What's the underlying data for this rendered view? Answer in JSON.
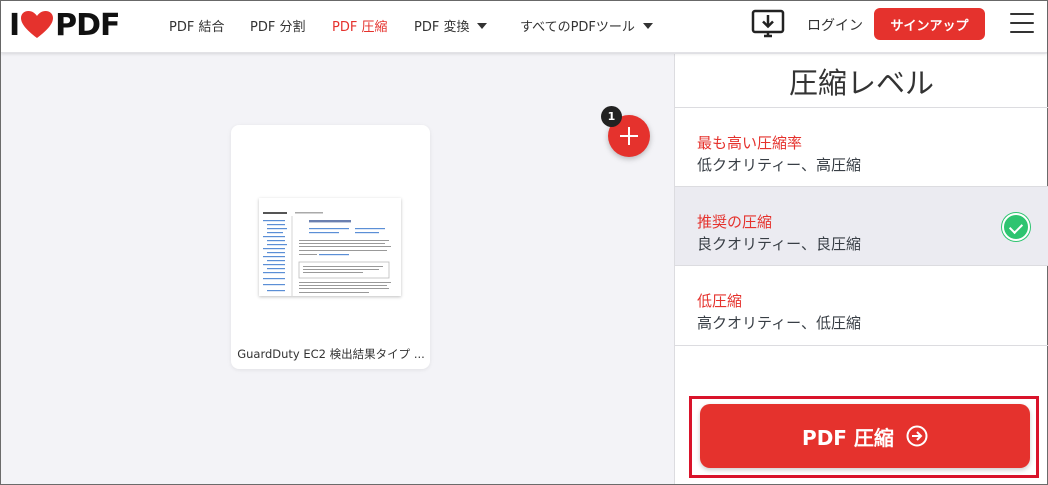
{
  "header": {
    "logo": {
      "left": "I",
      "right": "PDF"
    },
    "nav": [
      {
        "label": "PDF 結合",
        "active": false
      },
      {
        "label": "PDF 分割",
        "active": false
      },
      {
        "label": "PDF 圧縮",
        "active": true
      },
      {
        "label": "PDF 変換",
        "active": false,
        "dropdown": true
      },
      {
        "label": "すべてのPDFツール",
        "active": false,
        "dropdown": true
      }
    ],
    "desktop_icon": "desktop-download-icon",
    "login_label": "ログイン",
    "signup_label": "サインアップ",
    "menu_icon": "hamburger-menu-icon"
  },
  "workspace": {
    "file_count": "1",
    "file_name": "GuardDuty EC2 検出結果タイプ ...",
    "add_icon": "plus-icon"
  },
  "sidebar": {
    "title": "圧縮レベル",
    "options": [
      {
        "title": "最も高い圧縮率",
        "desc": "低クオリティー、高圧縮",
        "selected": false
      },
      {
        "title": "推奨の圧縮",
        "desc": "良クオリティー、良圧縮",
        "selected": true
      },
      {
        "title": "低圧縮",
        "desc": "高クオリティー、低圧縮",
        "selected": false
      }
    ],
    "compress_button_label": "PDF 圧縮"
  },
  "colors": {
    "brand_red": "#e5322d",
    "selected_bg": "#ebebf1",
    "check_green": "#2ec470",
    "highlight_border": "#d9132a"
  }
}
